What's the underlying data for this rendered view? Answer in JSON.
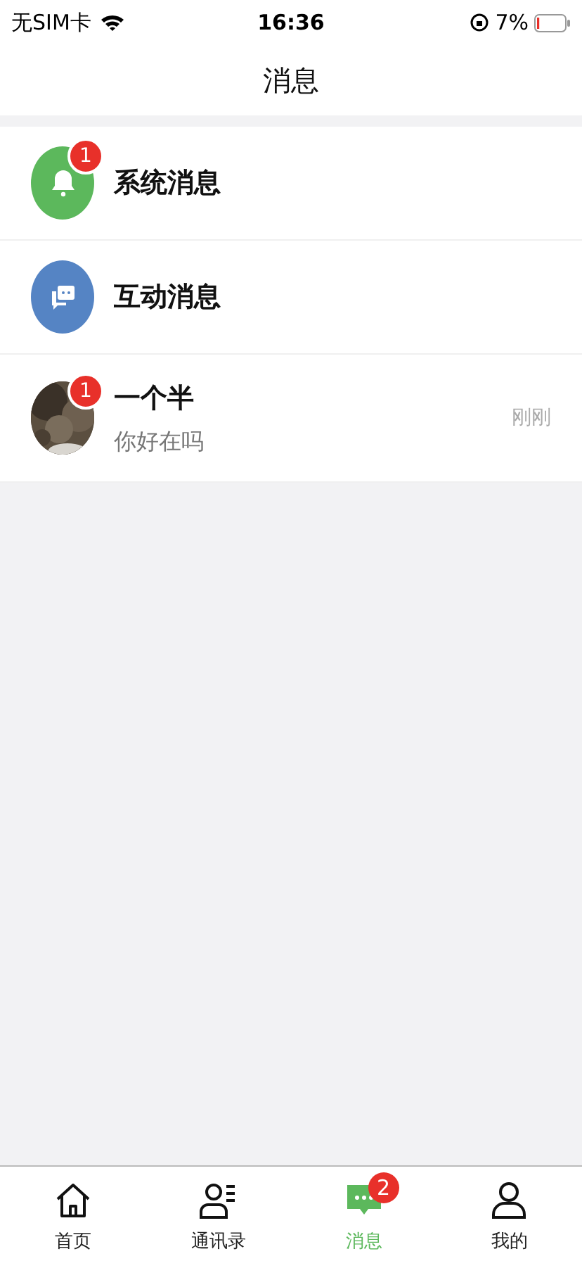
{
  "status_bar": {
    "carrier": "无SIM卡",
    "time": "16:36",
    "battery": "7%"
  },
  "header": {
    "title": "消息"
  },
  "conversations": [
    {
      "kind": "bell",
      "title": "系统消息",
      "badge": "1"
    },
    {
      "kind": "chat",
      "title": "互动消息"
    },
    {
      "title": "一个半",
      "badge": "1",
      "preview": "你好在吗",
      "time": "刚刚"
    }
  ],
  "tab_bar": [
    {
      "kind": "home",
      "label": "首页",
      "selected": false
    },
    {
      "kind": "contacts",
      "label": "通讯录",
      "selected": false
    },
    {
      "kind": "message",
      "label": "消息",
      "selected": true,
      "badge": "2"
    },
    {
      "kind": "profile",
      "label": "我的",
      "selected": false
    }
  ]
}
